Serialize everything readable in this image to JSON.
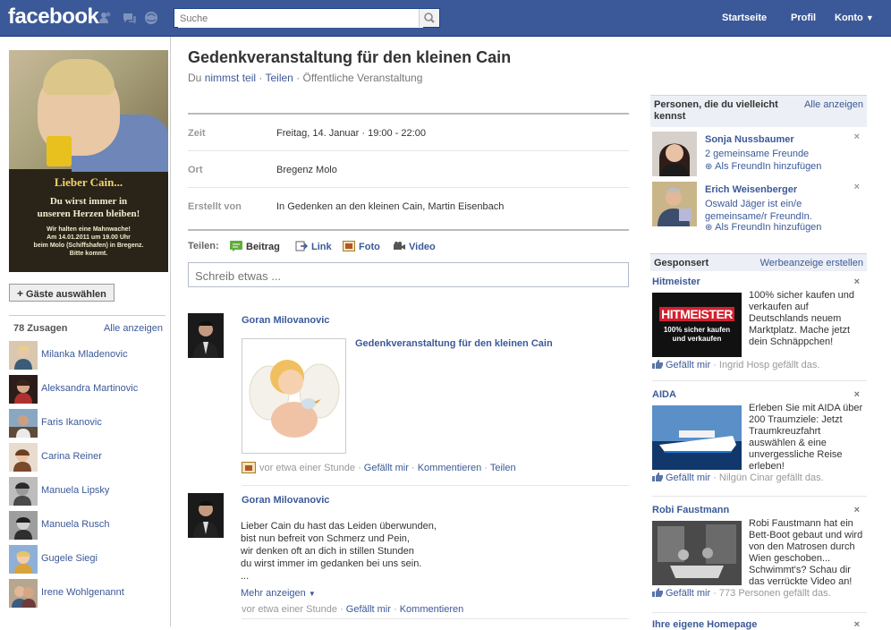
{
  "topbar": {
    "logo": "facebook",
    "search_placeholder": "Suche",
    "nav": [
      "Startseite",
      "Profil",
      "Konto"
    ]
  },
  "event_photo": {
    "line1": "Lieber Cain...",
    "line2": "Du wirst immer in",
    "line3": "unseren Herzen bleiben!",
    "small1": "Wir halten eine Mahnwache!",
    "small2": "Am 14.01.2011 um 19.00 Uhr",
    "small3": "beim Molo (Schiffshafen) in Bregenz.",
    "small4": "Bitte kommt."
  },
  "left": {
    "guest_button": "Gäste auswählen",
    "attending_count": "78 Zusagen",
    "attending_all": "Alle anzeigen",
    "attendees": [
      "Milanka Mladenovic",
      "Aleksandra Martinovic",
      "Faris Ikanovic",
      "Carina Reiner",
      "Manuela Lipsky",
      "Manuela Rusch",
      "Gugele Siegi",
      "Irene Wohlgenannt"
    ]
  },
  "event": {
    "title": "Gedenkveranstaltung für den kleinen Cain",
    "subtitle_prefix": "Du ",
    "subtitle_join": "nimmst teil",
    "subtitle_share": "Teilen",
    "subtitle_type": "Öffentliche Veranstaltung",
    "rows": [
      {
        "label": "Zeit",
        "value": "Freitag, 14. Januar · 19:00 - 22:00"
      },
      {
        "label": "Ort",
        "value": "Bregenz Molo"
      },
      {
        "label": "Erstellt von",
        "value": "In Gedenken an den kleinen Cain, Martin Eisenbach"
      }
    ]
  },
  "share": {
    "label": "Teilen:",
    "options": [
      "Beitrag",
      "Link",
      "Foto",
      "Video"
    ],
    "placeholder": "Schreib etwas ..."
  },
  "stories": [
    {
      "author": "Goran Milovanovic",
      "link_title": "Gedenkveranstaltung für den kleinen Cain",
      "time": "vor etwa einer Stunde",
      "actions": [
        "Gefällt mir",
        "Kommentieren",
        "Teilen"
      ]
    },
    {
      "author": "Goran Milovanovic",
      "text_lines": [
        "Lieber Cain du hast das Leiden überwunden,",
        "bist nun befreit von Schmerz und Pein,",
        "wir denken oft an dich in stillen Stunden",
        "du wirst immer im gedanken bei uns sein.",
        "..."
      ],
      "more": "Mehr anzeigen",
      "time": "vor etwa einer Stunde",
      "actions": [
        "Gefällt mir",
        "Kommentieren"
      ]
    }
  ],
  "pymk": {
    "title": "Personen, die du vielleicht kennst",
    "all": "Alle anzeigen",
    "people": [
      {
        "name": "Sonja Nussbaumer",
        "sub": "2 gemeinsame Freunde",
        "add": "Als FreundIn hinzufügen"
      },
      {
        "name": "Erich Weisenberger",
        "sub": "Oswald Jäger ist ein/e gemeinsame/r FreundIn.",
        "add": "Als FreundIn hinzufügen"
      }
    ]
  },
  "sponsored": {
    "title": "Gesponsert",
    "create": "Werbeanzeige erstellen",
    "ads": [
      {
        "title": "Hitmeister",
        "img_text1": "HITMEISTER",
        "img_text2": "100% sicher kaufen",
        "img_text3": "und verkaufen",
        "body": "100% sicher kaufen und verkaufen auf Deutschlands neuem Marktplatz. Mache jetzt dein Schnäppchen!",
        "like": "Gefällt mir",
        "like_suffix": "· Ingrid Hosp gefällt das."
      },
      {
        "title": "AIDA",
        "body": "Erleben Sie mit AIDA über 200 Traumziele: Jetzt Traumkreuzfahrt auswählen & eine unvergessliche Reise erleben!",
        "like": "Gefällt mir",
        "like_suffix": "· Nilgün Cinar gefällt das."
      },
      {
        "title": "Robi Faustmann",
        "body": "Robi Faustmann hat ein Bett-Boot gebaut und wird von den Matrosen durch Wien geschoben... Schwimmt's? Schau dir das verrückte Video an!",
        "like": "Gefällt mir",
        "like_suffix": "· 773 Personen gefällt das."
      },
      {
        "title": "Ihre eigene Homepage"
      }
    ]
  }
}
